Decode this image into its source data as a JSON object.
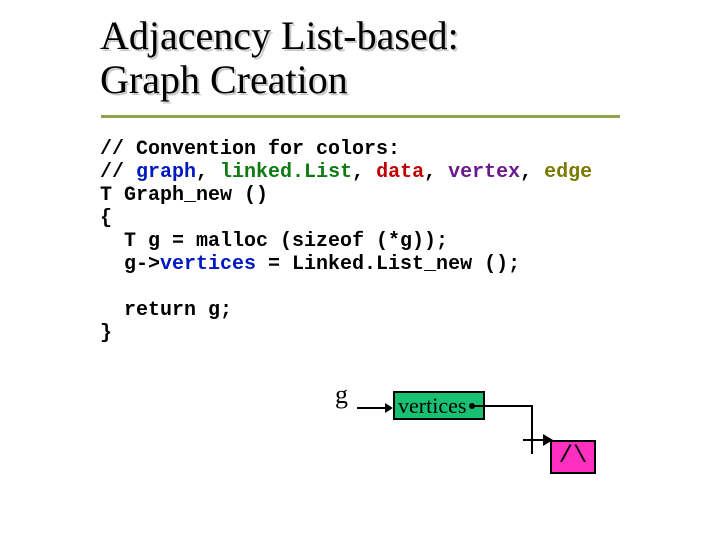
{
  "title_line1": "Adjacency List-based:",
  "title_line2": "Graph Creation",
  "code": {
    "l1_a": "// Convention for colors:",
    "l2_a": "// ",
    "l2_graph": "graph",
    "l2_s1": ", ",
    "l2_ll": "linked.List",
    "l2_s2": ", ",
    "l2_data": "data",
    "l2_s3": ", ",
    "l2_vertex": "vertex",
    "l2_s4": ", ",
    "l2_edge": "edge",
    "l3": "T Graph_new ()",
    "l4": "{",
    "l5": "  T g = malloc (sizeof (*g));",
    "l6_a": "  g->",
    "l6_b": "vertices",
    "l6_c": " = Linked.List_new ();",
    "l7": "",
    "l8": "  return g;",
    "l9": "}"
  },
  "diagram": {
    "g": "g",
    "vertices": "vertices",
    "null": "/\\"
  },
  "colors": {
    "graph": "#0018c0",
    "linkedList": "#0d7a12",
    "data": "#c00000",
    "vertex": "#6a1a8a",
    "edge": "#7a7a00",
    "vertBoxFill": "#18c172",
    "nullBoxFill": "#ff2fc0",
    "underline": "#8fa24f"
  }
}
